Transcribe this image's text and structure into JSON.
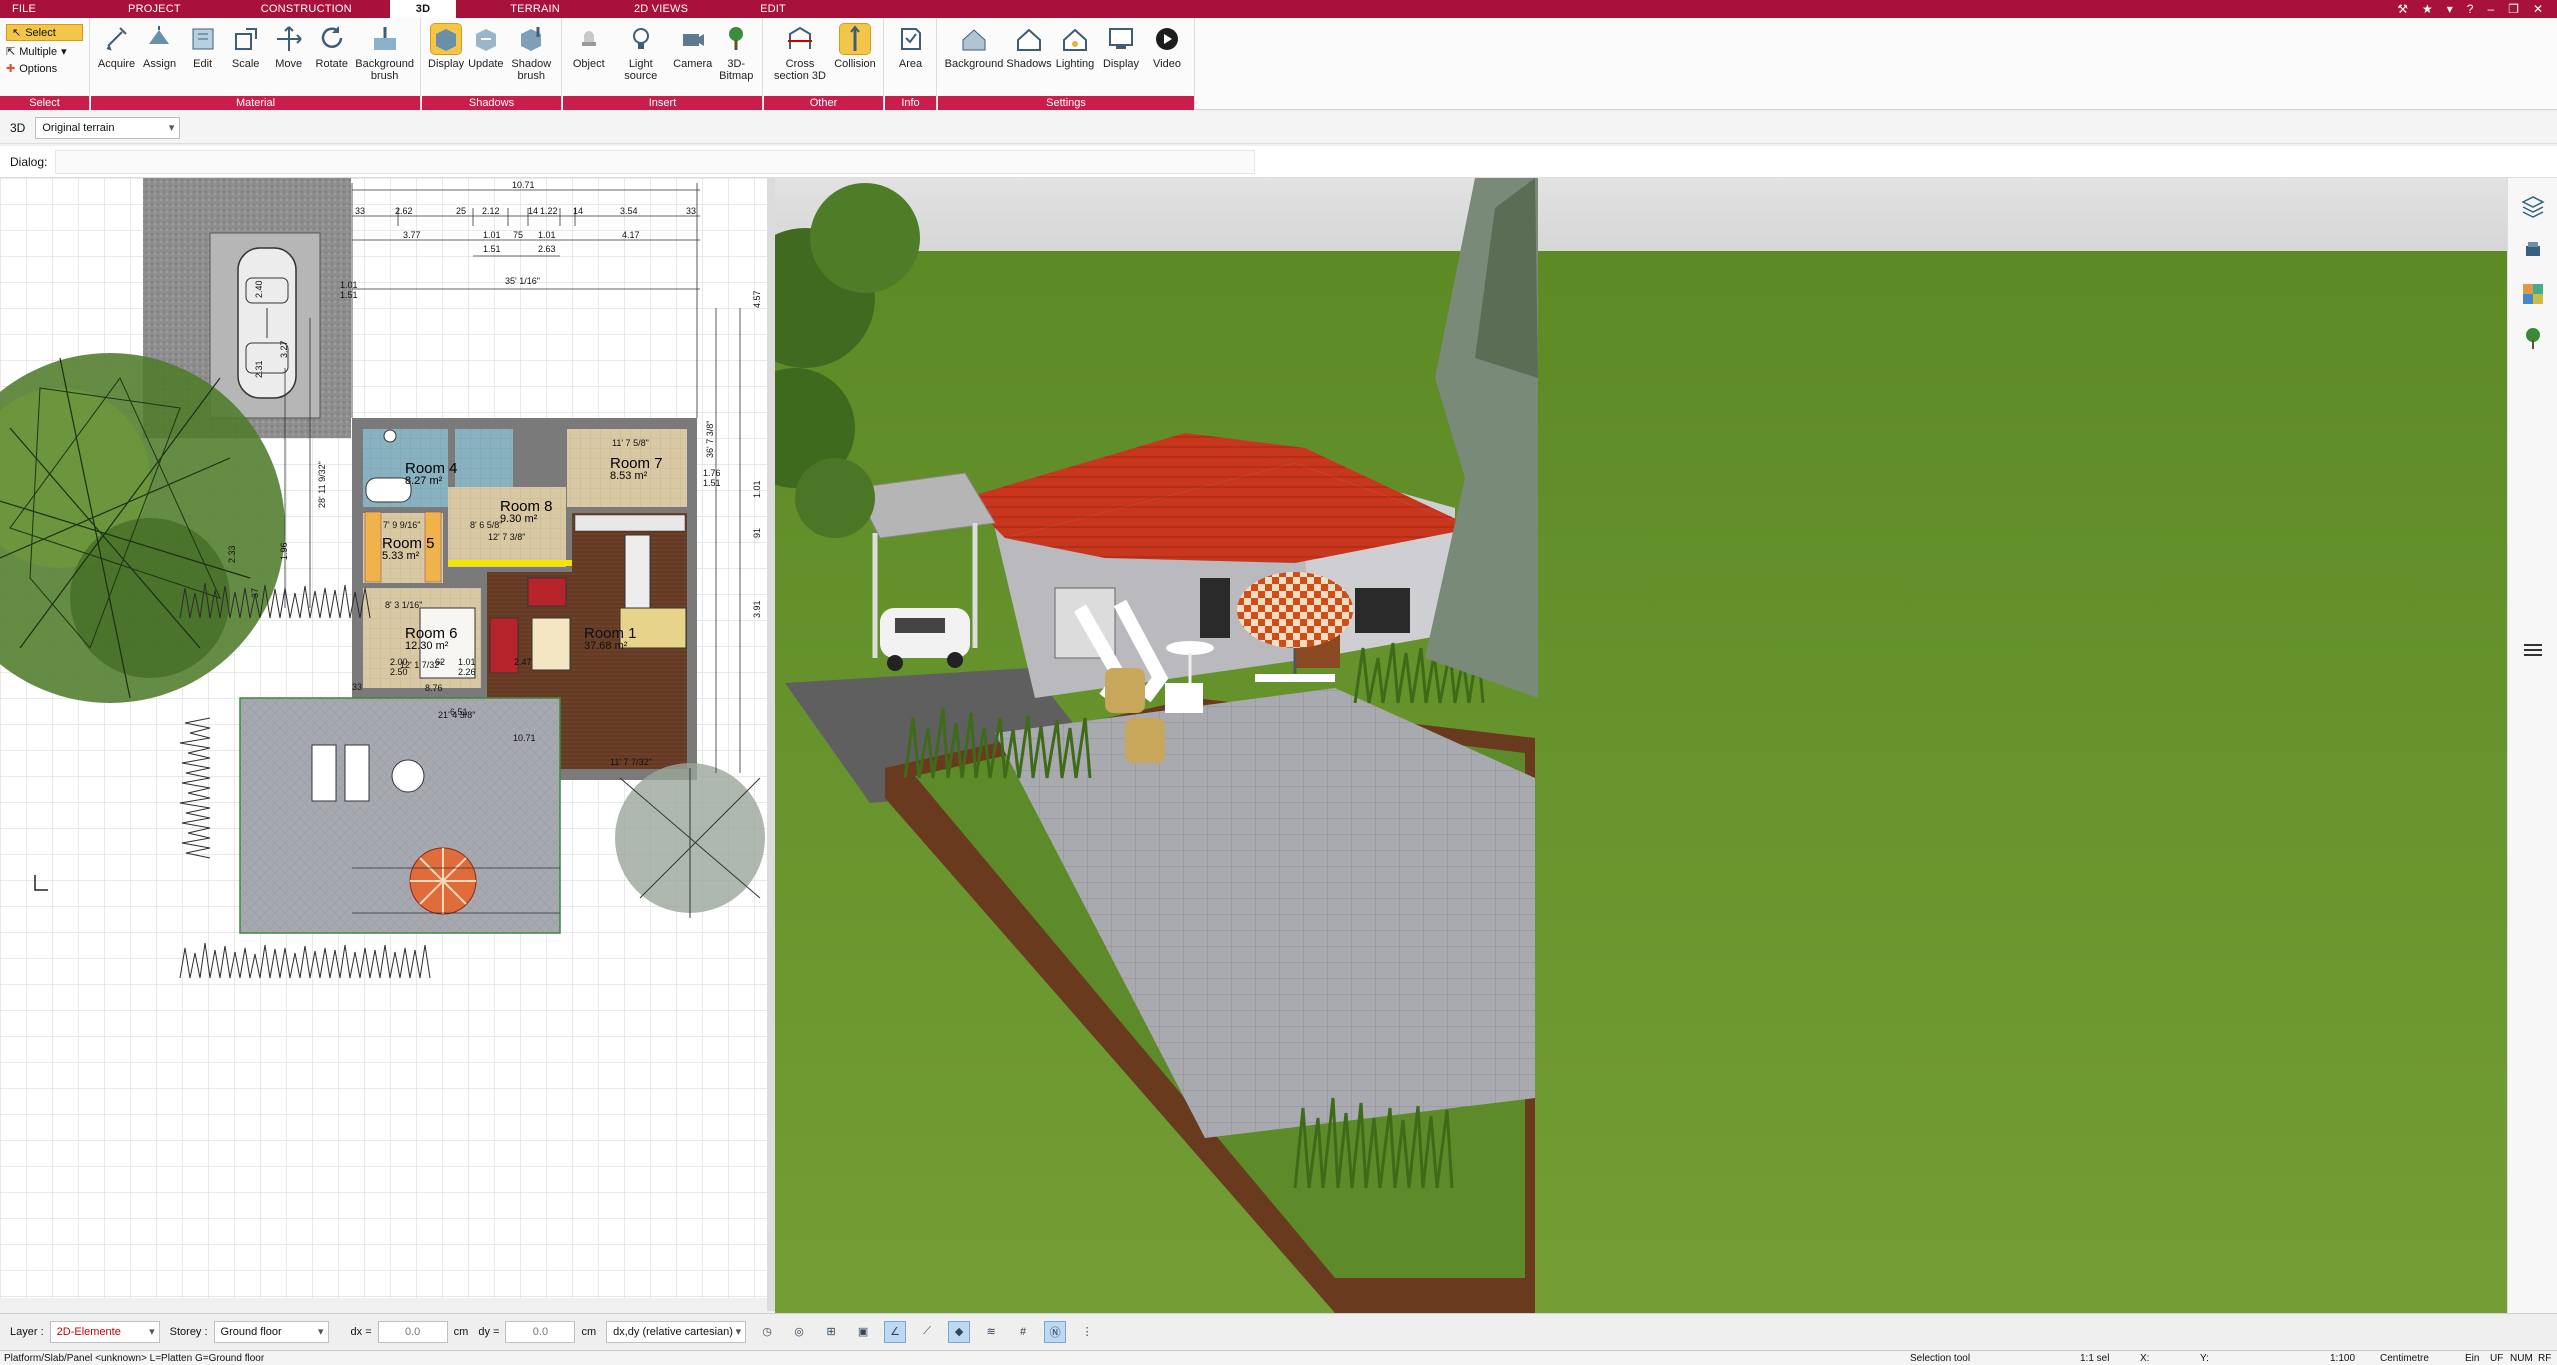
{
  "tabs": [
    {
      "label": "FILE"
    },
    {
      "label": "PROJECT"
    },
    {
      "label": "CONSTRUCTION"
    },
    {
      "label": "3D",
      "active": true
    },
    {
      "label": "TERRAIN"
    },
    {
      "label": "2D VIEWS"
    },
    {
      "label": "EDIT"
    }
  ],
  "ribbon": {
    "select": {
      "title": "Select",
      "select_label": "Select",
      "multiple_label": "Multiple",
      "options_label": "Options"
    },
    "material": {
      "title": "Material",
      "buttons": [
        "Acquire",
        "Assign",
        "Edit",
        "Scale",
        "Move",
        "Rotate",
        "Background brush"
      ]
    },
    "shadows": {
      "title": "Shadows",
      "buttons": [
        "Display",
        "Update",
        "Shadow brush"
      ]
    },
    "insert": {
      "title": "Insert",
      "buttons": [
        "Object",
        "Light source",
        "Camera",
        "3D-Bitmap"
      ]
    },
    "other": {
      "title": "Other",
      "buttons": [
        "Cross section 3D",
        "Collision"
      ]
    },
    "info": {
      "title": "Info",
      "buttons": [
        "Area"
      ]
    },
    "settings": {
      "title": "Settings",
      "buttons": [
        "Background",
        "Shadows",
        "Lighting",
        "Display",
        "Video"
      ]
    }
  },
  "view3d_bar": {
    "mode_label": "3D",
    "terrain_value": "Original terrain"
  },
  "dialog_label": "Dialog:",
  "plan": {
    "rooms": [
      {
        "name": "Room 1",
        "area": "37.68 m²"
      },
      {
        "name": "Room 4",
        "area": "8.27 m²"
      },
      {
        "name": "Room 5",
        "area": "5.33 m²"
      },
      {
        "name": "Room 6",
        "area": "12.30 m²"
      },
      {
        "name": "Room 7",
        "area": "8.53 m²"
      },
      {
        "name": "Room 8",
        "area": "9.30 m²"
      }
    ],
    "dims": {
      "top_total": "10.71",
      "d1": "2.62",
      "d2": "25",
      "d3": "2.12",
      "d4": "14",
      "d5": "1.22",
      "d6": "14",
      "d7": "3.54",
      "d8": "33",
      "d9": "33",
      "r2a": "3.77",
      "r2b": "1.01",
      "r2c": "75",
      "r2d": "1.01",
      "r2e": "4.17",
      "r3a": "1.51",
      "r3b": "2.63",
      "imp1": "35' 1/16\"",
      "imp2": "11' 7 5/8\"",
      "imp3": "8' 6 5/8\"",
      "imp4": "12' 7 3/8\"",
      "imp5": "8' 3 1/16\"",
      "imp6": "12' 1 7/32\"",
      "imp7": "7' 9 9/16\"",
      "imp8": "21' 4 3/8\"",
      "imp9": "11' 7 7/32\"",
      "imp10": "28' 11 9/32\"",
      "imp11": "36' 7 3/8\"",
      "right1": "4.57",
      "right2": "1.01",
      "right3": "91",
      "right4": "1.76",
      "right5": "3.91",
      "right6": "1.51",
      "bot_total": "10.71",
      "b1": "2.00",
      "b2": "62",
      "b3": "1.01",
      "b4": "2.47",
      "b5": "2.50",
      "b6": "2.26",
      "b7": "33",
      "b8": "6.51",
      "b9": "1.96",
      "b10": "2.33",
      "b11": "37",
      "b12": "2.40",
      "b13": "3.27",
      "b14": "2.31",
      "b15": "1.01",
      "b16": "1.51",
      "b17": "8.76"
    }
  },
  "bottom": {
    "layer_label": "Layer :",
    "layer_value": "2D-Elemente",
    "storey_label": "Storey :",
    "storey_value": "Ground floor",
    "dx_label": "dx =",
    "dx_value": "0.0",
    "dy_label": "dy =",
    "dy_value": "0.0",
    "unit_cm": "cm",
    "coord_mode": "dx,dy (relative cartesian)"
  },
  "status": {
    "left": "Platform/Slab/Panel <unknown> L=Platten G=Ground floor",
    "tool": "Selection tool",
    "sel": "1:1 sel",
    "x": "X:",
    "y": "Y:",
    "scale": "1:100",
    "unit": "Centimetre",
    "ein": "Ein",
    "uf": "UF",
    "num": "NUM",
    "rf": "RF"
  },
  "colors": {
    "accent": "#a8123a",
    "group_title": "#c91d4c",
    "highlight": "#f3c64a",
    "roof": "#c8371d",
    "grass": "#6d9a2c"
  }
}
